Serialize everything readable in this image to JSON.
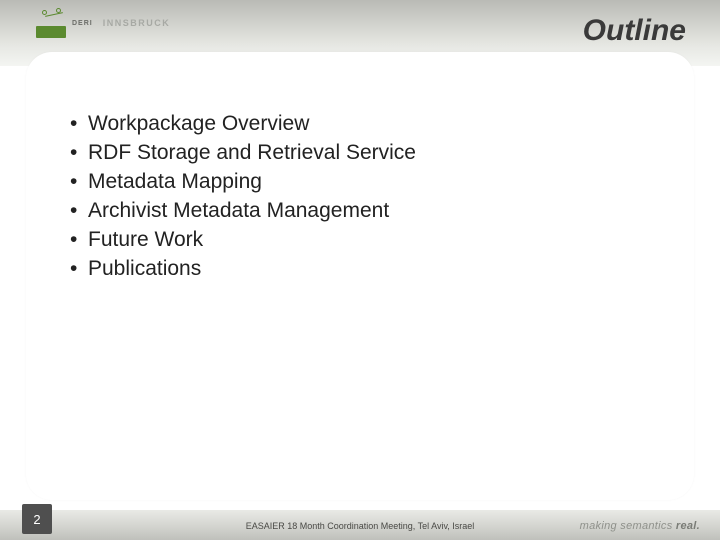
{
  "header": {
    "logo_word": "DERI",
    "logo_city": "INNSBRUCK",
    "title": "Outline"
  },
  "content": {
    "bullets": [
      "Workpackage Overview",
      "RDF Storage and Retrieval Service",
      "Metadata Mapping",
      "Archivist Metadata Management",
      "Future Work",
      "Publications"
    ]
  },
  "footer": {
    "page_number": "2",
    "center_text": "EASAIER 18 Month Coordination Meeting, Tel Aviv, Israel",
    "tagline_prefix": "making semantics ",
    "tagline_strong": "real."
  }
}
